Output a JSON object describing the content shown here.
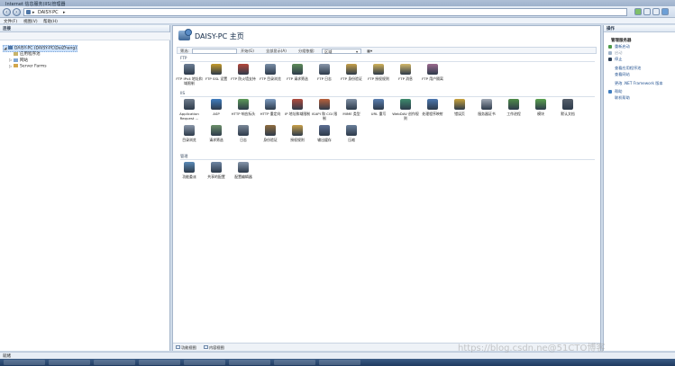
{
  "window": {
    "title": "Internet 信息服务(IIS)管理器"
  },
  "address": {
    "path": "DAISY-PC",
    "separator": "▸"
  },
  "menu": {
    "file": "文件(F)",
    "view": "视图(V)",
    "help": "帮助(H)"
  },
  "connections": {
    "header": "连接",
    "tree": {
      "server": "DAISY-PC (DAISY-PC\\DaiZhang)",
      "app_pools": "应用程序池",
      "sites": "网站",
      "server_farms": "Server Farms"
    }
  },
  "main": {
    "title": "DAISY-PC 主页",
    "filter_label": "筛选:",
    "go_label": "开始(G)",
    "show_all_label": "全部显示(A)",
    "group_by_label": "分组依据:",
    "group_by_value": "区域",
    "groups": {
      "ftp": "FTP",
      "iis": "IIS",
      "management": "管理"
    },
    "ftp_features": [
      {
        "label": "FTP IPv4 地址和域限制",
        "icon": "ftp-ip-restrictions-icon",
        "color": "#6d7f95"
      },
      {
        "label": "FTP SSL 设置",
        "icon": "ftp-ssl-icon",
        "color": "#c49a2b"
      },
      {
        "label": "FTP 防火墙支持",
        "icon": "ftp-firewall-icon",
        "color": "#b5473a"
      },
      {
        "label": "FTP 目录浏览",
        "icon": "ftp-directory-browsing-icon",
        "color": "#7a8fa8"
      },
      {
        "label": "FTP 请求筛选",
        "icon": "ftp-request-filtering-icon",
        "color": "#5f8c5a"
      },
      {
        "label": "FTP 日志",
        "icon": "ftp-logging-icon",
        "color": "#8a98ab"
      },
      {
        "label": "FTP 身份验证",
        "icon": "ftp-authentication-icon",
        "color": "#c7a14a"
      },
      {
        "label": "FTP 授权规则",
        "icon": "ftp-authorization-icon",
        "color": "#d1b25a"
      },
      {
        "label": "FTP 消息",
        "icon": "ftp-messages-icon",
        "color": "#d3b86a"
      },
      {
        "label": "FTP 用户隔离",
        "icon": "ftp-user-isolation-icon",
        "color": "#9c6a8f"
      }
    ],
    "iis_features": [
      {
        "label": "Application Request ...",
        "icon": "application-request-routing-icon",
        "color": "#6f7c8c"
      },
      {
        "label": "ASP",
        "icon": "asp-icon",
        "color": "#3f7dbf"
      },
      {
        "label": "HTTP 响应标头",
        "icon": "http-response-headers-icon",
        "color": "#5c9a58"
      },
      {
        "label": "HTTP 重定向",
        "icon": "http-redirect-icon",
        "color": "#7b9abf"
      },
      {
        "label": "IP 地址和域限制",
        "icon": "ip-restrictions-icon",
        "color": "#b04a3c"
      },
      {
        "label": "ISAPI 和 CGI 限制",
        "icon": "isapi-cgi-restrictions-icon",
        "color": "#b8603a"
      },
      {
        "label": "MIME 类型",
        "icon": "mime-types-icon",
        "color": "#7f8fa3"
      },
      {
        "label": "URL 重写",
        "icon": "url-rewrite-icon",
        "color": "#5a7fb0"
      },
      {
        "label": "WebDAV 创作规则",
        "icon": "webdav-authoring-icon",
        "color": "#3d8a6c"
      },
      {
        "label": "处理程序映射",
        "icon": "handler-mappings-icon",
        "color": "#4c78b0"
      },
      {
        "label": "错误页",
        "icon": "error-pages-icon",
        "color": "#c9a33c"
      },
      {
        "label": "服务器证书",
        "icon": "server-certificates-icon",
        "color": "#a0a8b4"
      },
      {
        "label": "工作进程",
        "icon": "worker-processes-icon",
        "color": "#4e8c48"
      },
      {
        "label": "模块",
        "icon": "modules-icon",
        "color": "#5aa24e"
      },
      {
        "label": "默认文档",
        "icon": "default-document-icon",
        "color": "#555e6a"
      },
      {
        "label": "目录浏览",
        "icon": "directory-browsing-icon",
        "color": "#8b98aa"
      },
      {
        "label": "请求筛选",
        "icon": "request-filtering-icon",
        "color": "#6c8f6a"
      },
      {
        "label": "日志",
        "icon": "logging-icon",
        "color": "#7a8797"
      },
      {
        "label": "身份验证",
        "icon": "authentication-icon",
        "color": "#8f6d3f"
      },
      {
        "label": "授权规则",
        "icon": "authorization-rules-icon",
        "color": "#c9a04a"
      },
      {
        "label": "输出缓存",
        "icon": "output-caching-icon",
        "color": "#5d6f93"
      },
      {
        "label": "压缩",
        "icon": "compression-icon",
        "color": "#6a7f9a"
      }
    ],
    "management_features": [
      {
        "label": "功能委派",
        "icon": "feature-delegation-icon",
        "color": "#5b8bb8"
      },
      {
        "label": "共享的配置",
        "icon": "shared-configuration-icon",
        "color": "#6f86a3"
      },
      {
        "label": "配置编辑器",
        "icon": "configuration-editor-icon",
        "color": "#8595aa"
      }
    ],
    "view_tabs": {
      "features": "功能视图",
      "content": "内容视图"
    }
  },
  "actions": {
    "header": "操作",
    "manage_server_header": "管理服务器",
    "restart": "重新启动",
    "start": "启动",
    "stop": "停止",
    "view_app_pools": "查看应用程序池",
    "view_sites": "查看网站",
    "change_dotnet": "更改 .NET Framework 版本",
    "help": "帮助",
    "online_help": "联机帮助"
  },
  "status": {
    "text": "就绪"
  },
  "watermark": "https://blog.csdn.ne@51CTO博客"
}
